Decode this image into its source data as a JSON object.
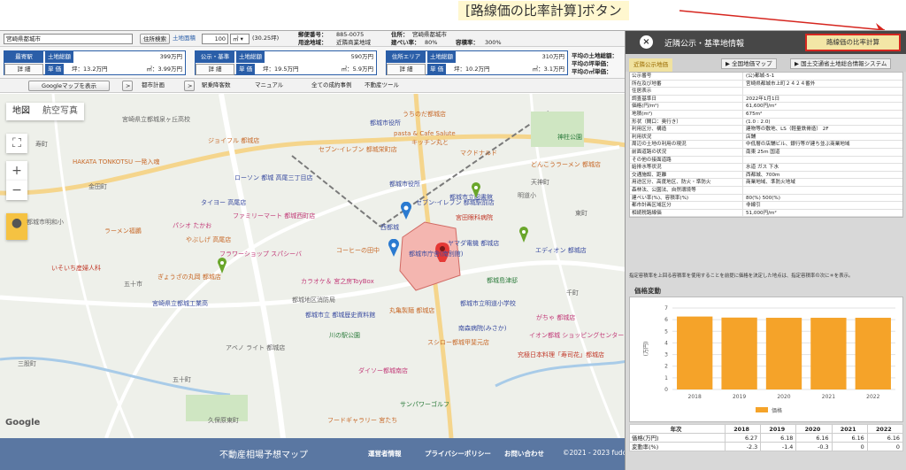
{
  "annotation": {
    "label": "[路線価の比率計算]ボタン",
    "color": "#d6261f"
  },
  "topbar": {
    "address": "宮崎県都城市",
    "search_button": "住所検索",
    "area_label": "土地面積",
    "area_value": "100",
    "area_unit": "㎡ ▾",
    "area_tsubo": "(30.25坪)",
    "postal_label": "郵便番号：",
    "postal_value": "885-0075",
    "use_label": "用途地域：",
    "use_value": "近隣商業地域",
    "address_label": "住所：",
    "address_value": "宮崎県都城市",
    "coverage_label": "建ぺい率：",
    "coverage_value": "80%",
    "far_label": "容積率：",
    "far_value": "300%"
  },
  "price_boxes": [
    {
      "category": "最寄駅",
      "detail": "詳 細",
      "total_label": "土地総額",
      "total": "399万円",
      "unit_label": "単 価",
      "tsubo": "坪：13.2万円",
      "sqm": "㎡：3.99万円"
    },
    {
      "category": "公示・基準",
      "detail": "詳 細",
      "total_label": "土地総額",
      "total": "590万円",
      "unit_label": "単 価",
      "tsubo": "坪：19.5万円",
      "sqm": "㎡：5.9万円"
    },
    {
      "category": "住所エリア",
      "detail": "詳 細",
      "total_label": "土地総額",
      "total": "310万円",
      "unit_label": "単 価",
      "tsubo": "坪：10.2万円",
      "sqm": "㎡：3.1万円"
    }
  ],
  "averages": [
    "平均の土地総額：",
    "平均の坪単価：",
    "平均の㎡単価："
  ],
  "subbar": {
    "google_btn": "Googleマップを表示",
    "arrow1": ">",
    "city_plan": "都市計画",
    "arrow2": ">",
    "station_count": "駅乗降客数",
    "manual": "マニュアル",
    "all_cases": "全ての成約事例",
    "tools": "不動産ツール"
  },
  "map": {
    "tab_map": "地図",
    "tab_satellite": "航空写真",
    "fullscreen_icon": "fullscreen-icon",
    "zoom_in": "+",
    "zoom_out": "−",
    "labels": [
      "うちのだ都城店",
      "宮崎県立都城泉ヶ丘高校",
      "都城市役所",
      "pasta & Cafe Salute",
      "キッチン丸と",
      "マクドナルド",
      "神柱公園",
      "ジョイフル 都城店",
      "セブン-イレブン 都城栄町店",
      "HAKATA TONKOTSU 一発入魂",
      "どんこうラーメン 都城店",
      "ローソン 都城 高尾三丁目店",
      "都城市役所",
      "都城市立図書館",
      "明道小",
      "セブン-イレブン 都城駅前店",
      "宮田眼科病院",
      "天神町",
      "タイヨー 高尾店",
      "西都城",
      "ファミリーマート 都城西町店",
      "パシオ たかお",
      "ラーメン福鵬",
      "やぶしげ 高尾店",
      "フラワーショップ スパシーバ",
      "コーヒーの田中",
      "都城市庁舎(南別館)",
      "ヤマダ電機 都城店",
      "エディオン 都城店",
      "いそいち産婦人科",
      "ぎょうざの丸岡 都城店",
      "五十市",
      "都城島津邸",
      "カラオケ＆ 宮之房ToyBox",
      "宮崎県立都城工業高",
      "都城市立明道小学校",
      "丸亀製麺 都城店",
      "都城地区消防局",
      "都城市立 都城歴史資料館",
      "南森病院(みさか)",
      "がちゃ 都城店",
      "川の駅公園",
      "スシロー都城甲斐元店",
      "イオン都城 ショッピングセンター",
      "アベノ ライト 都城店",
      "究極日本料理「寿司花」都城店",
      "ダイソー都城南店",
      "五十町",
      "サンパワーゴルフ",
      "久保原東町",
      "フードギャラリー 宮たち",
      "都城市明和小",
      "三股町",
      "東町",
      "寿町",
      "金田町",
      "千町"
    ],
    "google_logo": "Google"
  },
  "footer": {
    "title": "不動産相場予想マップ",
    "links": [
      "運営者情報",
      "プライバシーポリシー",
      "お問い合わせ"
    ],
    "copyright": "©2021 - 2023 fudo"
  },
  "panel": {
    "title": "近隣公示・基準地情報",
    "close": "×",
    "ratio_button": "路線価の比率計算",
    "tab_current": "近隣公示地価",
    "links": [
      "▶ 全国地価マップ",
      "▶ 国土交通省土地総合情報システム"
    ],
    "rows": [
      {
        "k": "公示番号",
        "v": "(公)都城-5-1"
      },
      {
        "k": "所在及び地番",
        "v": "宮崎県都城市上町２４２４番外"
      },
      {
        "k": "住居表示",
        "v": ""
      },
      {
        "k": "調査基準日",
        "v": "2022年1月1日"
      },
      {
        "k": "価格(円/m²)",
        "v": "61,600円/m²"
      },
      {
        "k": "地積(m²)",
        "v": "675m²"
      },
      {
        "k": "形状（間口：奥行き）",
        "v": "(1.0 : 2.0)"
      },
      {
        "k": "利用区分、構造",
        "v": "建物等の敷地、LS（軽量鉄骨造） 2F"
      },
      {
        "k": "利用状況",
        "v": "店舗"
      },
      {
        "k": "周辺の土地の利用の現況",
        "v": "中低層の店舗ビル、銀行等が建ち並ぶ商業地域"
      },
      {
        "k": "前面道路の状況",
        "v": "南東 25m 国道"
      },
      {
        "k": "その他の接面道路",
        "v": ""
      },
      {
        "k": "給排水等状況",
        "v": "水道 ガス 下水"
      },
      {
        "k": "交通施設、距離",
        "v": "西都城、700m"
      },
      {
        "k": "用途区分、高度地区、防火・準防火",
        "v": "商業地域、準防火地域"
      },
      {
        "k": "森林法、公園法、自然環境等",
        "v": ""
      },
      {
        "k": "建ぺい率(%)、容積率(%)",
        "v": "80(%) 500(%)"
      },
      {
        "k": "都市計画区域区分",
        "v": "非線引"
      },
      {
        "k": "相続税路線価",
        "v": "51,000円/m²"
      }
    ],
    "note": "指定容積率を上回る容積率を使用することを前提に価格を決定した地点は、指定容積率の次に＊を表示。",
    "price_history_title": "価格変動",
    "table": {
      "header": [
        "年次",
        "2018",
        "2019",
        "2020",
        "2021",
        "2022"
      ],
      "rows": [
        [
          "価格(万円)",
          "6.27",
          "6.18",
          "6.16",
          "6.16",
          "6.16"
        ],
        [
          "変動率(%)",
          "-2.3",
          "-1.4",
          "-0.3",
          "0",
          "0"
        ]
      ]
    }
  },
  "chart_data": {
    "type": "bar",
    "categories": [
      "2018",
      "2019",
      "2020",
      "2021",
      "2022"
    ],
    "series": [
      {
        "name": "価格",
        "values": [
          6.27,
          6.18,
          6.16,
          6.16,
          6.16
        ]
      }
    ],
    "ylabel": "(万円)",
    "ylim": [
      0,
      7
    ],
    "yticks": [
      "0",
      "1",
      "2",
      "3",
      "4",
      "5",
      "6",
      "7"
    ],
    "legend": "bottom",
    "color": "#f5a329",
    "grid": true
  }
}
